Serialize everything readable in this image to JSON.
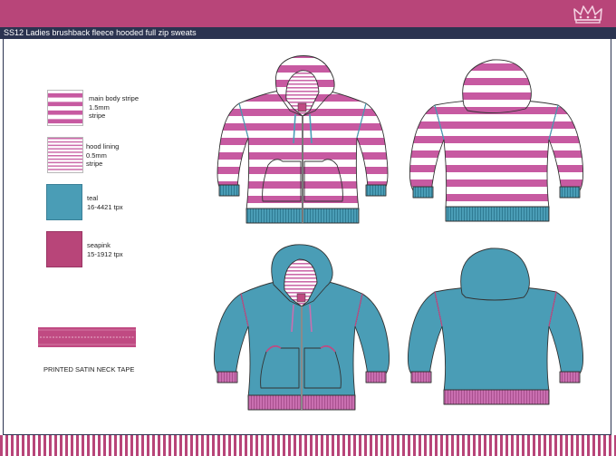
{
  "header": {
    "title": "SS12 Ladies brushback fleece hooded full zip sweats",
    "logo_icon": "crown-icon"
  },
  "colors": {
    "header_bar": "#b84579",
    "title_bar": "#2b3350",
    "stripe_pink": "#c75aa1",
    "teal": "#4a9db6",
    "seapink": "#b84579",
    "rib_pink": "#c96fb0",
    "rib_teal": "#3f8fa8"
  },
  "legend": {
    "main_stripe": "main body stripe\n1.5mm\nstripe",
    "hood_lining": "hood lining\n0.5mm\nstripe",
    "teal": "teal\n16-4421 tpx",
    "seapink": "seapink\n15-1912 tpx"
  },
  "neck_tape_label": "PRINTED SATIN NECK TAPE",
  "views": [
    {
      "name": "stripe-front",
      "variant": "striped",
      "side": "front"
    },
    {
      "name": "stripe-back",
      "variant": "striped",
      "side": "back"
    },
    {
      "name": "teal-front",
      "variant": "teal",
      "side": "front"
    },
    {
      "name": "teal-back",
      "variant": "teal",
      "side": "back"
    }
  ]
}
